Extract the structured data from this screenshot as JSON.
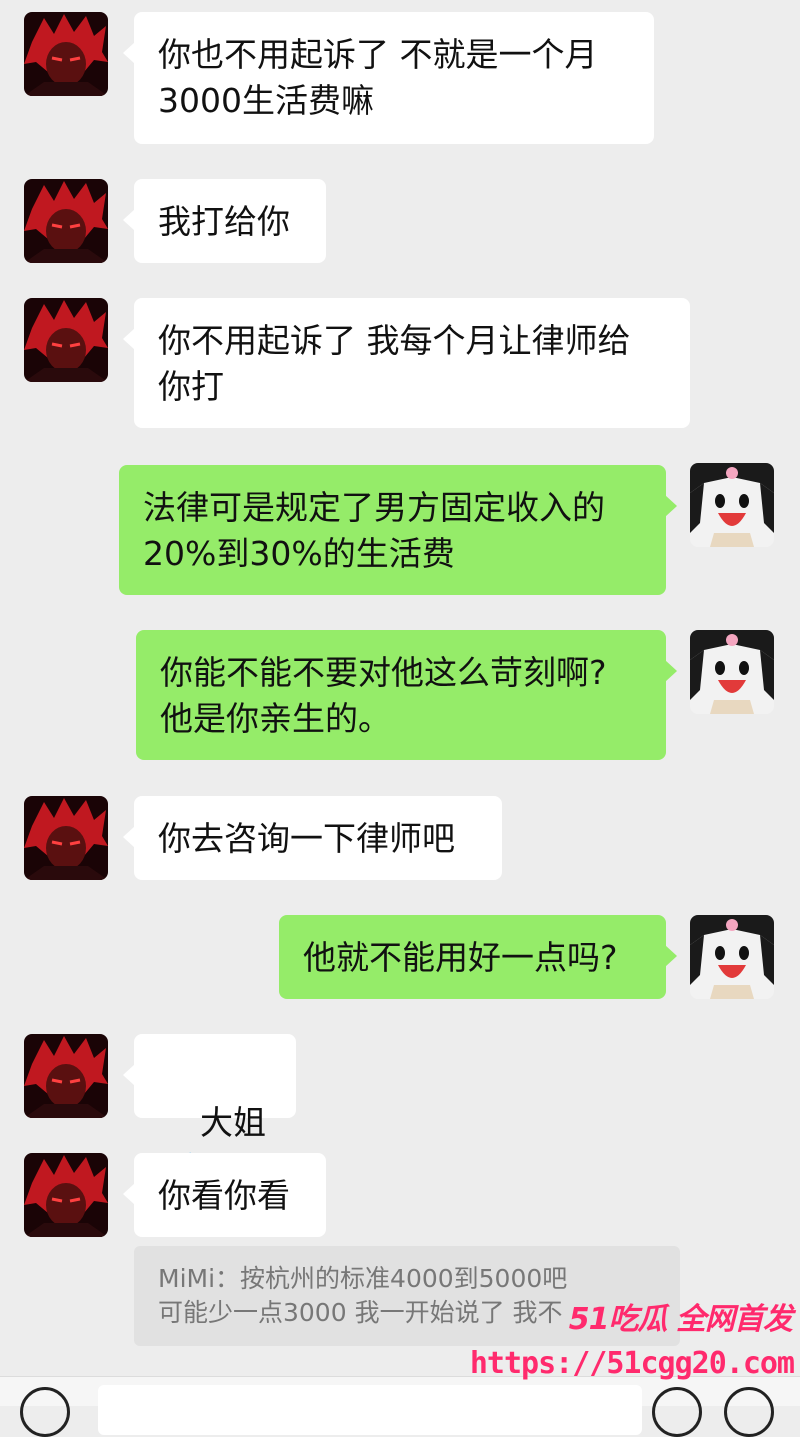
{
  "messages": [
    {
      "side": "left",
      "text": "你也不用起诉了 不就是一个月\n3000生活费嘛"
    },
    {
      "side": "left",
      "text": "我打给你"
    },
    {
      "side": "left",
      "text": "你不用起诉了 我每个月让律师给\n你打"
    },
    {
      "side": "right",
      "text": "法律可是规定了男方固定收入的\n20%到30%的生活费"
    },
    {
      "side": "right",
      "text": "你能不能不要对他这么苛刻啊?\n他是你亲生的。"
    },
    {
      "side": "left",
      "text": "你去咨询一下律师吧"
    },
    {
      "side": "right",
      "text": "他就不能用好一点吗?"
    },
    {
      "side": "left",
      "text": "大姐",
      "emoji": "sweat-cry-emoji"
    },
    {
      "side": "left",
      "text": "你看你看"
    }
  ],
  "quote": {
    "text": "MiMi：按杭州的标准4000到5000吧\n可能少一点3000 我一开始说了 我不"
  },
  "watermark": {
    "brand": "51吃瓜 全网首发",
    "url": "https://51cgg20.com"
  },
  "colors": {
    "background": "#ededed",
    "incoming_bubble": "#ffffff",
    "outgoing_bubble": "#95ec69",
    "watermark": "#ff2a6d"
  }
}
